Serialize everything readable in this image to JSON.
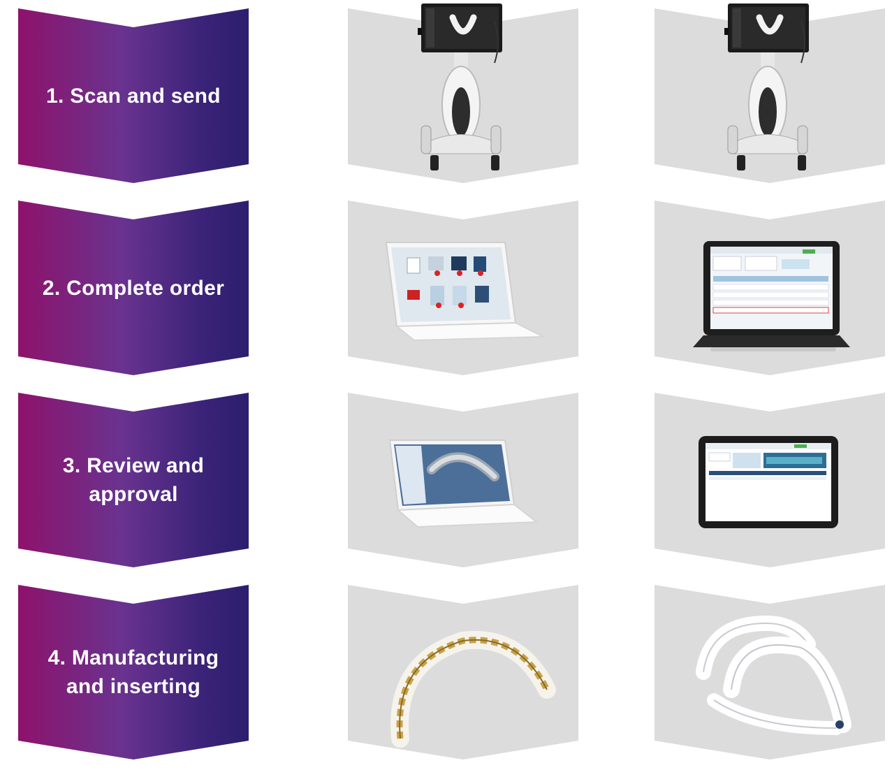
{
  "steps": [
    {
      "label": "1. Scan and send"
    },
    {
      "label": "2. Complete order"
    },
    {
      "label": "3. Review and\napproval"
    },
    {
      "label": "4. Manufacturing\nand inserting"
    }
  ],
  "panels": [
    {
      "left_image": "intraoral-scanner",
      "right_image": "intraoral-scanner"
    },
    {
      "left_image": "laptop-order-software",
      "right_image": "all-in-one-order-portal"
    },
    {
      "left_image": "laptop-3d-review",
      "right_image": "tablet-approval-portal"
    },
    {
      "left_image": "lingual-brackets",
      "right_image": "clear-aligners"
    }
  ],
  "colors": {
    "gradient_start": "#8e126b",
    "gradient_end": "#2c1e6e",
    "panel_gray": "#dcdcdc",
    "label_text": "#ffffff"
  }
}
